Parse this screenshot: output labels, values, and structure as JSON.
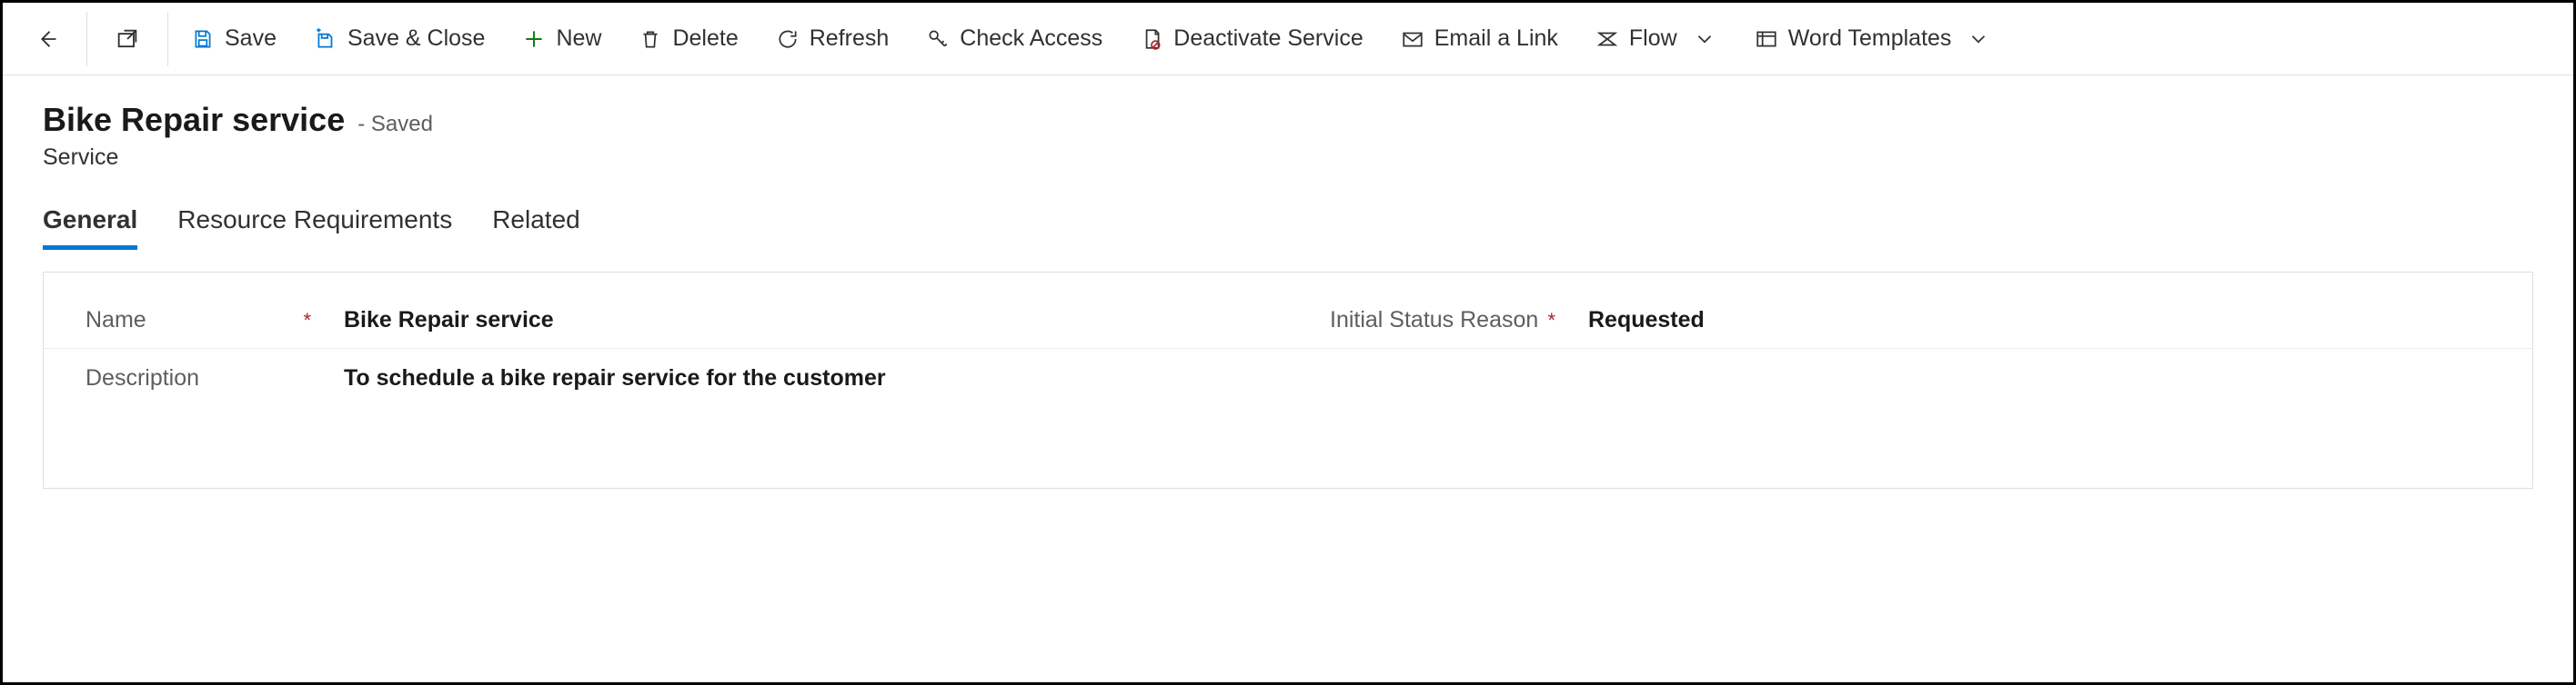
{
  "toolbar": {
    "save": "Save",
    "save_close": "Save & Close",
    "new": "New",
    "delete": "Delete",
    "refresh": "Refresh",
    "check_access": "Check Access",
    "deactivate": "Deactivate Service",
    "email_link": "Email a Link",
    "flow": "Flow",
    "word_templates": "Word Templates"
  },
  "header": {
    "title": "Bike Repair service",
    "saved": "- Saved",
    "entity": "Service"
  },
  "tabs": {
    "general": "General",
    "resource_requirements": "Resource Requirements",
    "related": "Related"
  },
  "form": {
    "name_label": "Name",
    "name_value": "Bike Repair service",
    "status_label": "Initial Status Reason",
    "status_value": "Requested",
    "description_label": "Description",
    "description_value": "To schedule a bike repair service for the customer",
    "required": "*"
  }
}
